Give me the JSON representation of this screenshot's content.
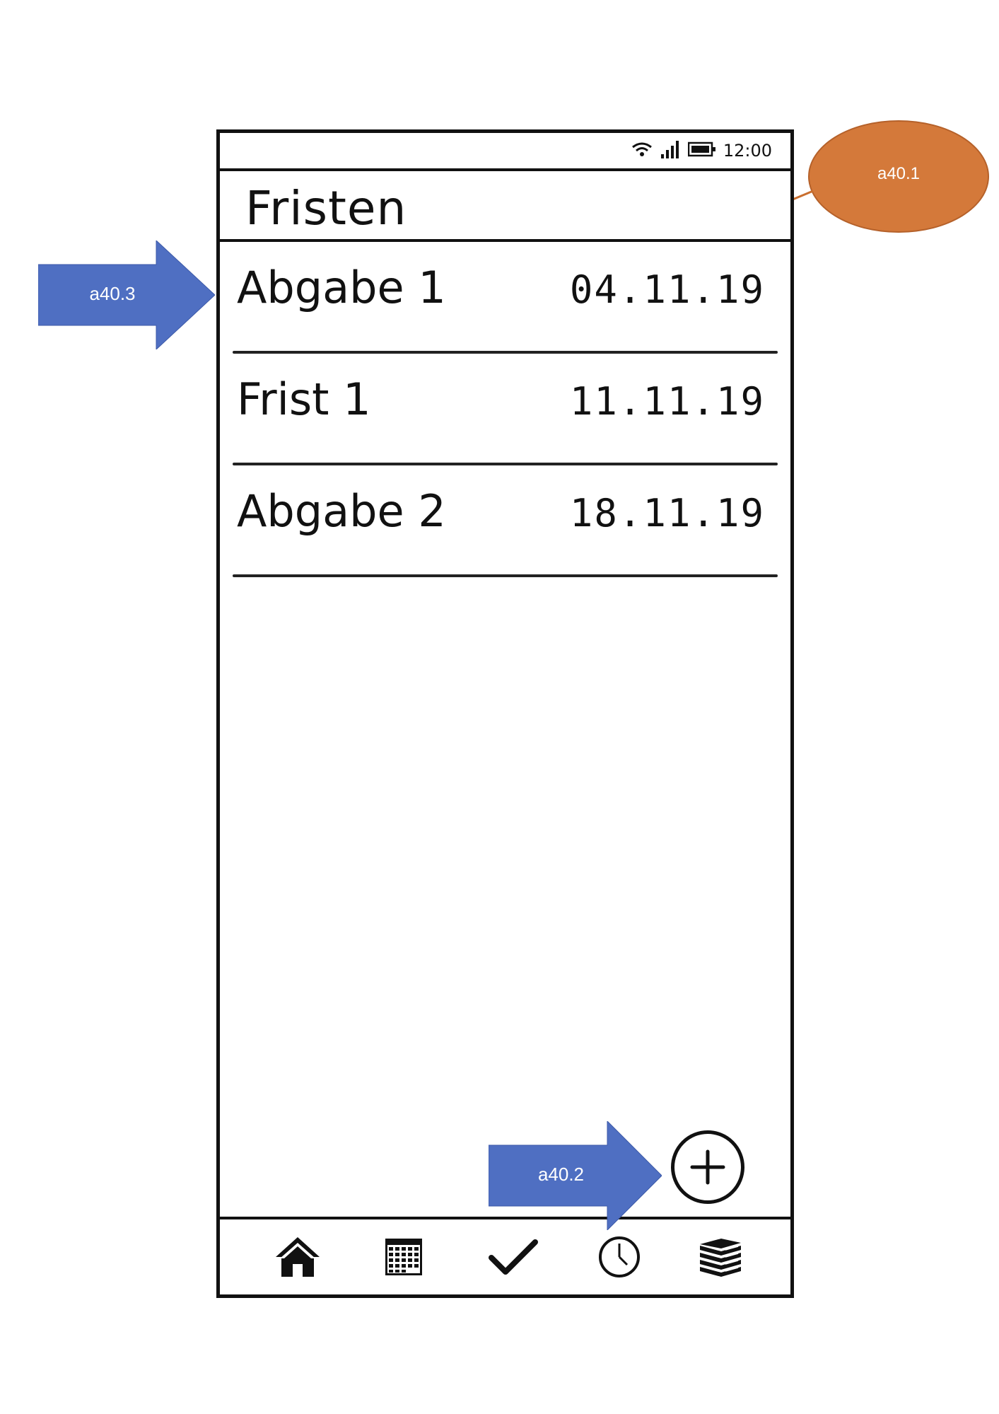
{
  "status_bar": {
    "time": "12:00"
  },
  "header": {
    "title": "Fristen"
  },
  "deadlines": [
    {
      "name": "Abgabe 1",
      "date": "04.11.19"
    },
    {
      "name": "Frist 1",
      "date": "11.11.19"
    },
    {
      "name": "Abgabe 2",
      "date": "18.11.19"
    }
  ],
  "fab": {
    "icon": "plus-icon"
  },
  "bottom_nav": [
    {
      "icon": "home-icon"
    },
    {
      "icon": "calendar-icon"
    },
    {
      "icon": "checkmark-icon"
    },
    {
      "icon": "clock-icon"
    },
    {
      "icon": "books-icon"
    }
  ],
  "annotations": {
    "a1": "a40.1",
    "a2": "a40.2",
    "a3": "a40.3",
    "colors": {
      "arrow_blue": "#4f6fc2",
      "bubble_orange": "#d4793a"
    }
  }
}
